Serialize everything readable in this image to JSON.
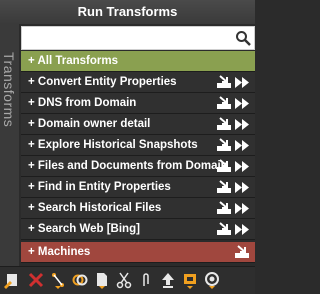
{
  "window": {
    "title": "Run Transforms"
  },
  "side_tab": {
    "label": "Transforms"
  },
  "search": {
    "value": "",
    "placeholder": ""
  },
  "colors": {
    "all_row": "#8aa050",
    "item_row": "#303030",
    "machines_row": "#a0473e"
  },
  "transforms": {
    "all_label": "+  All Transforms",
    "items": [
      {
        "label": "+  Convert Entity Properties"
      },
      {
        "label": "+  DNS from Domain"
      },
      {
        "label": "+  Domain owner detail"
      },
      {
        "label": "+  Explore Historical Snapshots"
      },
      {
        "label": "+  Files and Documents from Domain"
      },
      {
        "label": "+  Find in Entity Properties"
      },
      {
        "label": "+  Search Historical Files"
      },
      {
        "label": "+  Search Web [Bing]"
      }
    ],
    "machines_label": "+  Machines"
  },
  "toolbar": {
    "icons": [
      "delete-entity-icon",
      "remove-icon",
      "link-icon",
      "rings-icon",
      "document-icon",
      "cut-icon",
      "attach-icon",
      "up-arrow-icon",
      "frame-icon",
      "target-icon"
    ]
  }
}
